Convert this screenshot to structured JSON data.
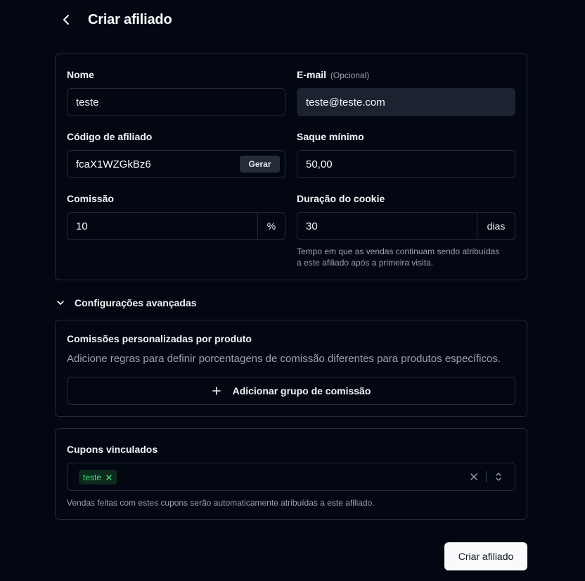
{
  "header": {
    "title": "Criar afiliado",
    "back_icon": "chevron-left-icon"
  },
  "form": {
    "name": {
      "label": "Nome",
      "value": "teste"
    },
    "email": {
      "label": "E-mail",
      "optional": "(Opcional)",
      "value": "teste@teste.com"
    },
    "affiliate_code": {
      "label": "Código de afiliado",
      "value": "fcaX1WZGkBz6",
      "generate_label": "Gerar"
    },
    "min_withdrawal": {
      "label": "Saque mínimo",
      "value": "50,00"
    },
    "commission": {
      "label": "Comissão",
      "value": "10",
      "suffix": "%"
    },
    "cookie_duration": {
      "label": "Duração do cookie",
      "value": "30",
      "suffix": "dias",
      "help_line1": "Tempo em que as vendas continuam sendo atribuídas",
      "help_line2": "a este afiliado após a primeira visita."
    }
  },
  "advanced": {
    "label": "Configurações avançadas",
    "icon": "chevron-down-icon",
    "product_commissions": {
      "title": "Comissões personalizadas por produto",
      "description": "Adicione regras para definir porcentagens de comissão diferentes para produtos específicos.",
      "add_button_label": "Adicionar grupo de comissão"
    }
  },
  "coupons": {
    "title": "Cupons vinculados",
    "selected": [
      "teste"
    ],
    "help": "Vendas feitas com estes cupons serão automaticamente atribuídas a este afiliado."
  },
  "submit_label": "Criar afiliado",
  "colors": {
    "background": "#030712",
    "border": "#262b36",
    "chip_text": "#4ade80",
    "button_bg": "#f9fafb"
  }
}
